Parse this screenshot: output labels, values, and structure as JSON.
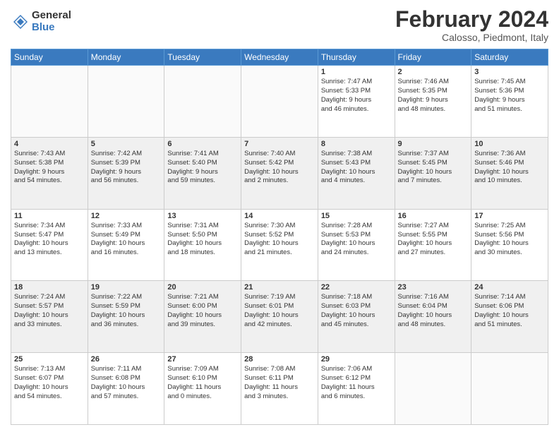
{
  "logo": {
    "general": "General",
    "blue": "Blue"
  },
  "header": {
    "month": "February 2024",
    "location": "Calosso, Piedmont, Italy"
  },
  "days_of_week": [
    "Sunday",
    "Monday",
    "Tuesday",
    "Wednesday",
    "Thursday",
    "Friday",
    "Saturday"
  ],
  "weeks": [
    [
      {
        "day": "",
        "info": ""
      },
      {
        "day": "",
        "info": ""
      },
      {
        "day": "",
        "info": ""
      },
      {
        "day": "",
        "info": ""
      },
      {
        "day": "1",
        "info": "Sunrise: 7:47 AM\nSunset: 5:33 PM\nDaylight: 9 hours\nand 46 minutes."
      },
      {
        "day": "2",
        "info": "Sunrise: 7:46 AM\nSunset: 5:35 PM\nDaylight: 9 hours\nand 48 minutes."
      },
      {
        "day": "3",
        "info": "Sunrise: 7:45 AM\nSunset: 5:36 PM\nDaylight: 9 hours\nand 51 minutes."
      }
    ],
    [
      {
        "day": "4",
        "info": "Sunrise: 7:43 AM\nSunset: 5:38 PM\nDaylight: 9 hours\nand 54 minutes."
      },
      {
        "day": "5",
        "info": "Sunrise: 7:42 AM\nSunset: 5:39 PM\nDaylight: 9 hours\nand 56 minutes."
      },
      {
        "day": "6",
        "info": "Sunrise: 7:41 AM\nSunset: 5:40 PM\nDaylight: 9 hours\nand 59 minutes."
      },
      {
        "day": "7",
        "info": "Sunrise: 7:40 AM\nSunset: 5:42 PM\nDaylight: 10 hours\nand 2 minutes."
      },
      {
        "day": "8",
        "info": "Sunrise: 7:38 AM\nSunset: 5:43 PM\nDaylight: 10 hours\nand 4 minutes."
      },
      {
        "day": "9",
        "info": "Sunrise: 7:37 AM\nSunset: 5:45 PM\nDaylight: 10 hours\nand 7 minutes."
      },
      {
        "day": "10",
        "info": "Sunrise: 7:36 AM\nSunset: 5:46 PM\nDaylight: 10 hours\nand 10 minutes."
      }
    ],
    [
      {
        "day": "11",
        "info": "Sunrise: 7:34 AM\nSunset: 5:47 PM\nDaylight: 10 hours\nand 13 minutes."
      },
      {
        "day": "12",
        "info": "Sunrise: 7:33 AM\nSunset: 5:49 PM\nDaylight: 10 hours\nand 16 minutes."
      },
      {
        "day": "13",
        "info": "Sunrise: 7:31 AM\nSunset: 5:50 PM\nDaylight: 10 hours\nand 18 minutes."
      },
      {
        "day": "14",
        "info": "Sunrise: 7:30 AM\nSunset: 5:52 PM\nDaylight: 10 hours\nand 21 minutes."
      },
      {
        "day": "15",
        "info": "Sunrise: 7:28 AM\nSunset: 5:53 PM\nDaylight: 10 hours\nand 24 minutes."
      },
      {
        "day": "16",
        "info": "Sunrise: 7:27 AM\nSunset: 5:55 PM\nDaylight: 10 hours\nand 27 minutes."
      },
      {
        "day": "17",
        "info": "Sunrise: 7:25 AM\nSunset: 5:56 PM\nDaylight: 10 hours\nand 30 minutes."
      }
    ],
    [
      {
        "day": "18",
        "info": "Sunrise: 7:24 AM\nSunset: 5:57 PM\nDaylight: 10 hours\nand 33 minutes."
      },
      {
        "day": "19",
        "info": "Sunrise: 7:22 AM\nSunset: 5:59 PM\nDaylight: 10 hours\nand 36 minutes."
      },
      {
        "day": "20",
        "info": "Sunrise: 7:21 AM\nSunset: 6:00 PM\nDaylight: 10 hours\nand 39 minutes."
      },
      {
        "day": "21",
        "info": "Sunrise: 7:19 AM\nSunset: 6:01 PM\nDaylight: 10 hours\nand 42 minutes."
      },
      {
        "day": "22",
        "info": "Sunrise: 7:18 AM\nSunset: 6:03 PM\nDaylight: 10 hours\nand 45 minutes."
      },
      {
        "day": "23",
        "info": "Sunrise: 7:16 AM\nSunset: 6:04 PM\nDaylight: 10 hours\nand 48 minutes."
      },
      {
        "day": "24",
        "info": "Sunrise: 7:14 AM\nSunset: 6:06 PM\nDaylight: 10 hours\nand 51 minutes."
      }
    ],
    [
      {
        "day": "25",
        "info": "Sunrise: 7:13 AM\nSunset: 6:07 PM\nDaylight: 10 hours\nand 54 minutes."
      },
      {
        "day": "26",
        "info": "Sunrise: 7:11 AM\nSunset: 6:08 PM\nDaylight: 10 hours\nand 57 minutes."
      },
      {
        "day": "27",
        "info": "Sunrise: 7:09 AM\nSunset: 6:10 PM\nDaylight: 11 hours\nand 0 minutes."
      },
      {
        "day": "28",
        "info": "Sunrise: 7:08 AM\nSunset: 6:11 PM\nDaylight: 11 hours\nand 3 minutes."
      },
      {
        "day": "29",
        "info": "Sunrise: 7:06 AM\nSunset: 6:12 PM\nDaylight: 11 hours\nand 6 minutes."
      },
      {
        "day": "",
        "info": ""
      },
      {
        "day": "",
        "info": ""
      }
    ]
  ]
}
